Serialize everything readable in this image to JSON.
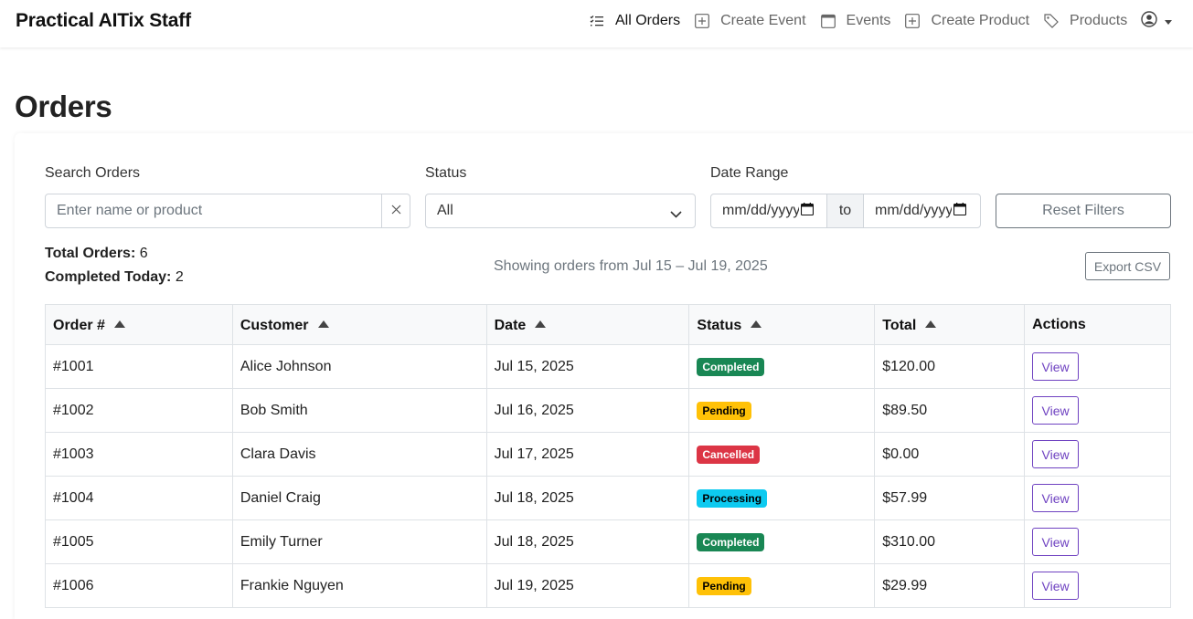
{
  "app": {
    "brand": "Practical AITix Staff"
  },
  "nav": {
    "items": [
      {
        "label": "All Orders",
        "icon": "list-icon",
        "active": true
      },
      {
        "label": "Create Event",
        "icon": "plus-square-icon",
        "active": false
      },
      {
        "label": "Events",
        "icon": "calendar-icon",
        "active": false
      },
      {
        "label": "Create Product",
        "icon": "plus-square-icon",
        "active": false
      },
      {
        "label": "Products",
        "icon": "tags-icon",
        "active": false
      }
    ],
    "user_icon": "user-circle-icon"
  },
  "page": {
    "title": "Orders"
  },
  "filters": {
    "search_label": "Search Orders",
    "search_placeholder": "Enter name or product",
    "status_label": "Status",
    "status_value": "All",
    "date_label": "Date Range",
    "date_from": "mm/dd/yyyy",
    "date_to_separator": "to",
    "date_to": "mm/dd/yyyy",
    "reset_label": "Reset Filters"
  },
  "summary": {
    "total_orders_label": "Total Orders:",
    "total_orders_value": "6",
    "completed_today_label": "Completed Today:",
    "completed_today_value": "2",
    "showing_text": "Showing orders from Jul 15 – Jul 19, 2025",
    "export_label": "Export CSV"
  },
  "table": {
    "columns": [
      "Order #",
      "Customer",
      "Date",
      "Status",
      "Total",
      "Actions"
    ],
    "rows": [
      {
        "order": "#1001",
        "customer": "Alice Johnson",
        "date": "Jul 15, 2025",
        "status": "Completed",
        "total": "$120.00",
        "action": "View"
      },
      {
        "order": "#1002",
        "customer": "Bob Smith",
        "date": "Jul 16, 2025",
        "status": "Pending",
        "total": "$89.50",
        "action": "View"
      },
      {
        "order": "#1003",
        "customer": "Clara Davis",
        "date": "Jul 17, 2025",
        "status": "Cancelled",
        "total": "$0.00",
        "action": "View"
      },
      {
        "order": "#1004",
        "customer": "Daniel Craig",
        "date": "Jul 18, 2025",
        "status": "Processing",
        "total": "$57.99",
        "action": "View"
      },
      {
        "order": "#1005",
        "customer": "Emily Turner",
        "date": "Jul 18, 2025",
        "status": "Completed",
        "total": "$310.00",
        "action": "View"
      },
      {
        "order": "#1006",
        "customer": "Frankie Nguyen",
        "date": "Jul 19, 2025",
        "status": "Pending",
        "total": "$29.99",
        "action": "View"
      }
    ]
  },
  "status_colors": {
    "Completed": {
      "bg": "#198754",
      "fg": "#ffffff"
    },
    "Pending": {
      "bg": "#ffc107",
      "fg": "#000000"
    },
    "Cancelled": {
      "bg": "#dc3545",
      "fg": "#ffffff"
    },
    "Processing": {
      "bg": "#0dcaf0",
      "fg": "#000000"
    }
  },
  "colors": {
    "accent": "#6f42c1",
    "muted": "#6c757d"
  }
}
